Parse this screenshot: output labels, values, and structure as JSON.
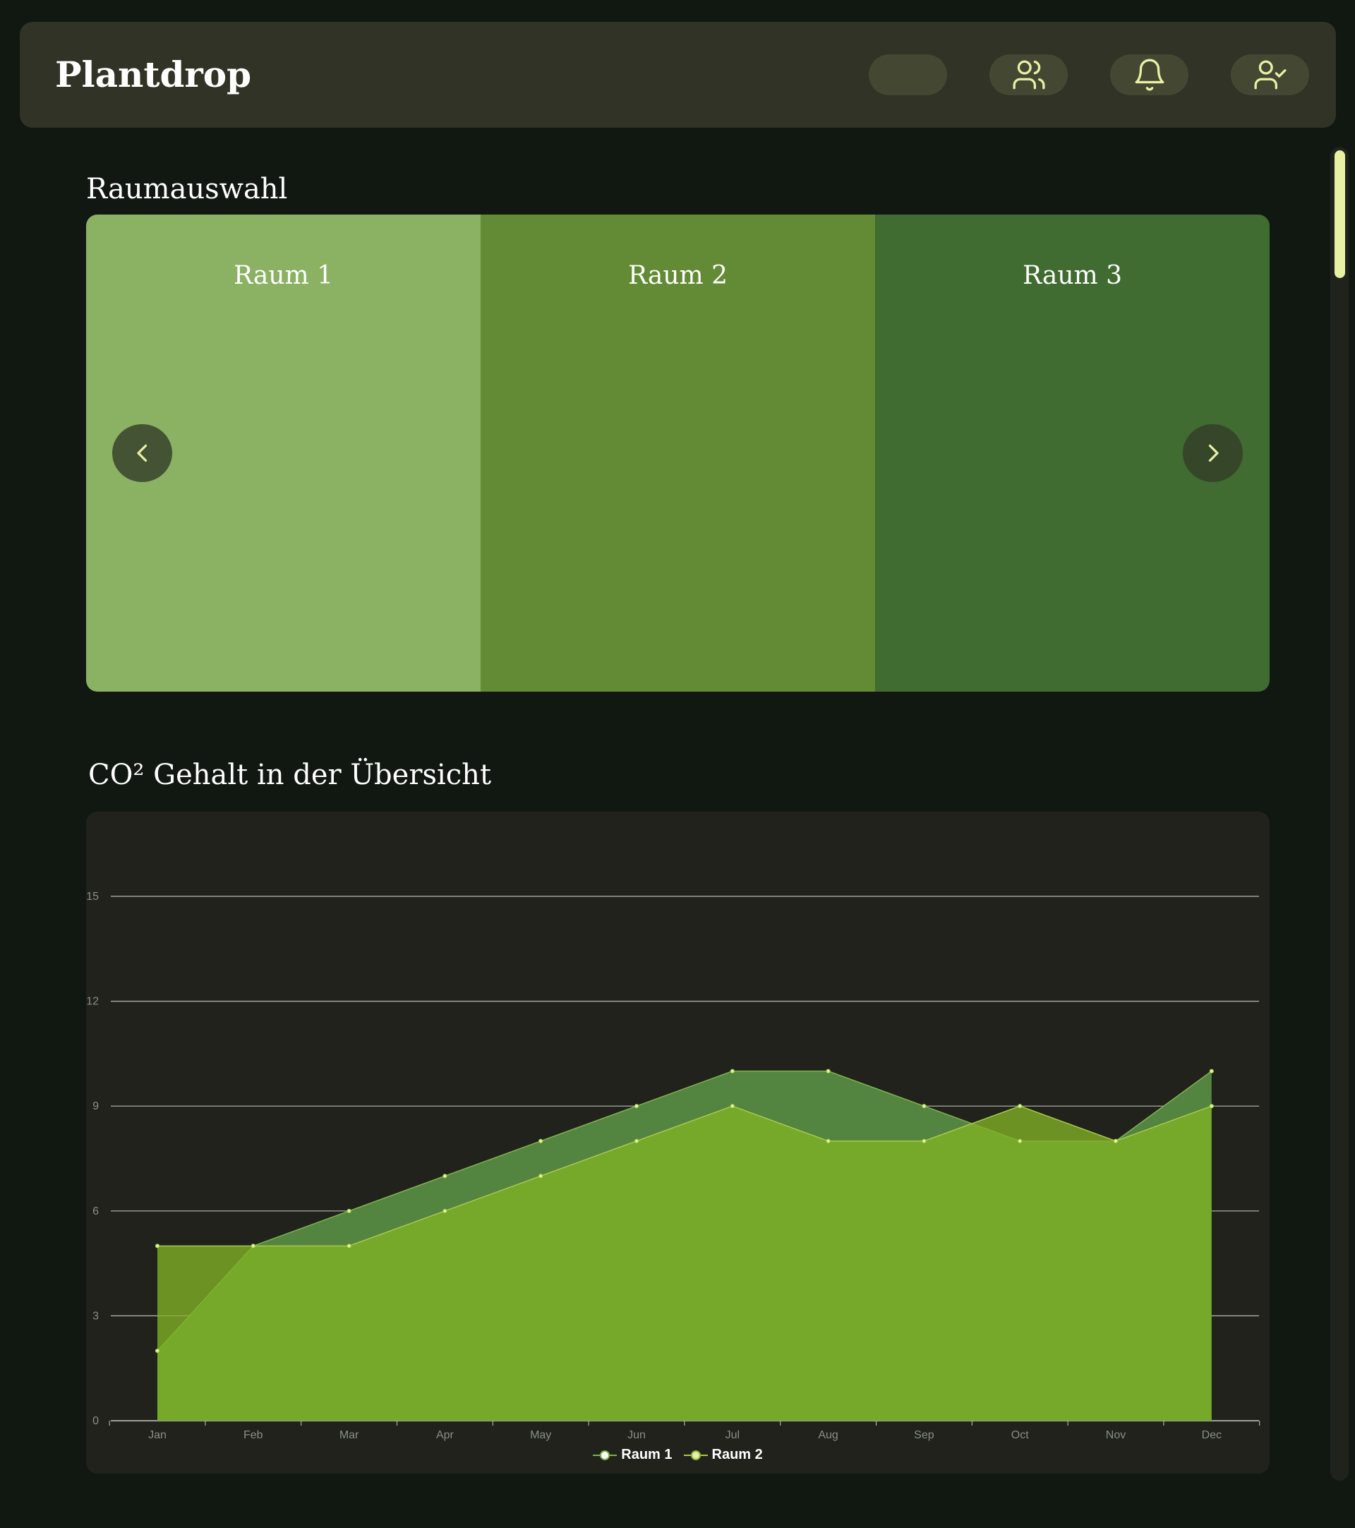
{
  "header": {
    "brand": "Plantdrop",
    "buttons": [
      {
        "icon": "blank-pill"
      },
      {
        "icon": "users-icon"
      },
      {
        "icon": "bell-icon"
      },
      {
        "icon": "user-check-icon"
      }
    ]
  },
  "rooms": {
    "title": "Raumauswahl",
    "items": [
      {
        "label": "Raum 1",
        "color": "#8bb163"
      },
      {
        "label": "Raum 2",
        "color": "#638a35"
      },
      {
        "label": "Raum 3",
        "color": "#406b31"
      }
    ],
    "prev_icon": "chevron-left-icon",
    "next_icon": "chevron-right-icon"
  },
  "co2": {
    "title": "CO² Gehalt in der Übersicht"
  },
  "colors": {
    "background": "#111811",
    "header": "#303325",
    "accent": "#e8f0a4",
    "raum1_fill": "#548540",
    "raum2_fill": "#72a32d"
  },
  "chart_data": {
    "type": "area",
    "categories": [
      "Jan",
      "Feb",
      "Mar",
      "Apr",
      "May",
      "Jun",
      "Jul",
      "Aug",
      "Sep",
      "Oct",
      "Nov",
      "Dec"
    ],
    "series": [
      {
        "name": "Raum 1",
        "values": [
          2,
          5,
          6,
          7,
          8,
          9,
          10,
          10,
          9,
          8,
          8,
          10
        ]
      },
      {
        "name": "Raum 2",
        "values": [
          5,
          5,
          5,
          6,
          7,
          8,
          9,
          8,
          8,
          9,
          8,
          9
        ]
      }
    ],
    "ylim": [
      0,
      15
    ],
    "yticks": [
      0,
      3,
      6,
      9,
      12,
      15
    ],
    "grid": true,
    "legend": "bottom-center"
  }
}
